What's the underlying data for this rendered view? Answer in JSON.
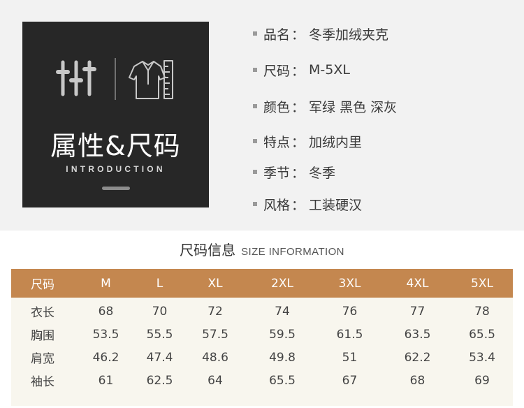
{
  "badge": {
    "title": "属性&尺码",
    "subtitle": "INTRODUCTION",
    "icons": [
      "sliders-icon",
      "shirt-ruler-icon"
    ]
  },
  "attributes": [
    {
      "label": "品名",
      "value": "冬季加绒夹克"
    },
    {
      "label": "尺码",
      "value": "M-5XL"
    },
    {
      "label": "颜色",
      "value": "军绿 黑色 深灰"
    },
    {
      "label": "特点",
      "value": "加绒内里"
    },
    {
      "label": "季节",
      "value": "冬季"
    },
    {
      "label": "风格",
      "value": "工装硬汉"
    }
  ],
  "attr_separator": "：",
  "size_section": {
    "title_cn": "尺码信息",
    "title_en": "SIZE INFORMATION"
  },
  "size_table": {
    "header": [
      "尺码",
      "M",
      "L",
      "XL",
      "2XL",
      "3XL",
      "4XL",
      "5XL"
    ],
    "rows": [
      [
        "衣长",
        "68",
        "70",
        "72",
        "74",
        "76",
        "77",
        "78"
      ],
      [
        "胸围",
        "53.5",
        "55.5",
        "57.5",
        "59.5",
        "61.5",
        "63.5",
        "65.5"
      ],
      [
        "肩宽",
        "46.2",
        "47.4",
        "48.6",
        "49.8",
        "51",
        "62.2",
        "53.4"
      ],
      [
        "袖长",
        "61",
        "62.5",
        "64",
        "65.5",
        "67",
        "68",
        "69"
      ]
    ]
  },
  "colors": {
    "header_bg": "#c4874f",
    "panel_bg": "#272727",
    "table_bg": "#f8f6ee",
    "top_bg": "#f2f2f2"
  }
}
